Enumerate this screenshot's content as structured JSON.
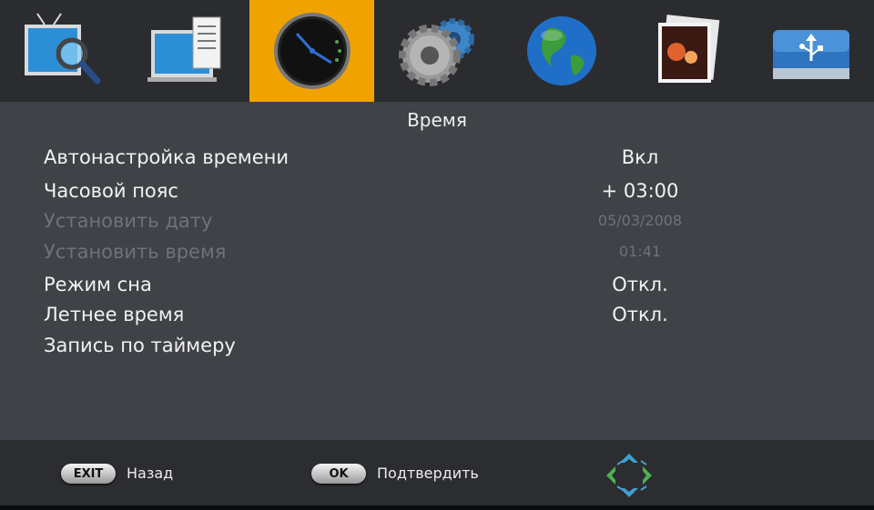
{
  "menu": {
    "tabs": [
      {
        "name": "tv-search-icon",
        "active": false
      },
      {
        "name": "tv-list-icon",
        "active": false
      },
      {
        "name": "clock-icon",
        "active": true
      },
      {
        "name": "gears-icon",
        "active": false
      },
      {
        "name": "globe-icon",
        "active": false
      },
      {
        "name": "photo-icon",
        "active": false
      },
      {
        "name": "usb-drive-icon",
        "active": false
      }
    ],
    "active_color": "#f0a300"
  },
  "page": {
    "title": "Время"
  },
  "settings": [
    {
      "label": "Автонастройка времени",
      "value": "Вкл",
      "enabled": true
    },
    {
      "label": "Часовой пояс",
      "value": "+ 03:00",
      "enabled": true
    },
    {
      "label": "Установить дату",
      "value": "05/03/2008",
      "enabled": false
    },
    {
      "label": "Установить время",
      "value": "01:41",
      "enabled": false
    },
    {
      "label": "Режим сна",
      "value": "Откл.",
      "enabled": true
    },
    {
      "label": "Летнее время",
      "value": "Откл.",
      "enabled": true
    },
    {
      "label": "Запись по таймеру",
      "value": "",
      "enabled": true
    }
  ],
  "footer": {
    "exit_key": "EXIT",
    "exit_label": "Назад",
    "ok_key": "OK",
    "ok_label": "Подтвердить",
    "nav_icon": "navigation-arrows-icon"
  }
}
